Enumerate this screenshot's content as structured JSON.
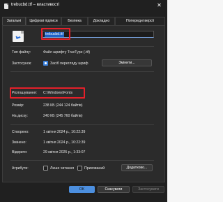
{
  "window": {
    "title": "trebucbd.ttf – властивості",
    "close_glyph": "✕"
  },
  "tabs": [
    {
      "label": "Загальні",
      "active": true
    },
    {
      "label": "Цифрові підписи",
      "active": false
    },
    {
      "label": "Безпека",
      "active": false
    },
    {
      "label": "Докладно",
      "active": false
    },
    {
      "label": "Попередні версії",
      "active": false
    }
  ],
  "file": {
    "name": "trebucbd.ttf",
    "icon": "font-file-icon"
  },
  "fields": {
    "type_label": "Тип файлу:",
    "type_value": "Файл шрифту TrueType (.ttf)",
    "opens_label": "Застосунок:",
    "opens_value": "Засіб перегляду шриф",
    "change_button": "Змінити...",
    "location_label": "Розташування:",
    "location_value": "C:\\Windows\\Fonts",
    "size_label": "Розмір:",
    "size_value": "238 КБ (244 124 байтів)",
    "disk_label": "На диску:",
    "disk_value": "240 КБ (245 760 байтів)",
    "created_label": "Створено:",
    "created_value": "1 квітня 2024 р., 10:22:39",
    "modified_label": "Змінено:",
    "modified_value": "1 квітня 2024 р., 10:22:39",
    "accessed_label": "Відкрито:",
    "accessed_value": "29 квітня 2025 р., 1:33:07",
    "attributes_label": "Атрибути:",
    "readonly_label": "Лише читання",
    "hidden_label": "Прихований",
    "advanced_button": "Додатково..."
  },
  "footer": {
    "ok": "OK",
    "cancel": "Скасувати",
    "apply": "Застосувати"
  },
  "colors": {
    "highlight": "#e5202a",
    "accent": "#4c8fdf"
  }
}
